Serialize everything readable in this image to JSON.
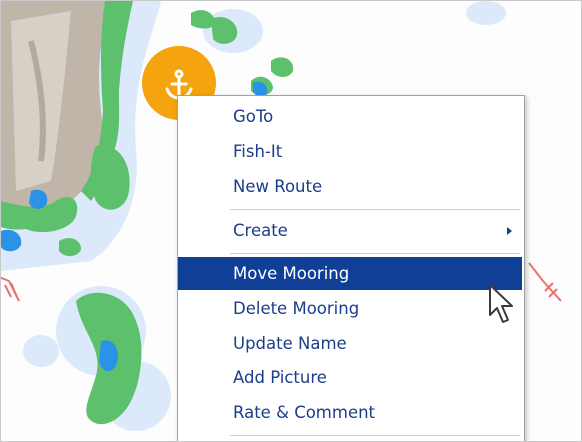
{
  "context_menu": {
    "items": [
      {
        "label": "GoTo"
      },
      {
        "label": "Fish-It"
      },
      {
        "label": "New Route"
      },
      {
        "label": "Create"
      },
      {
        "label": "Move Mooring"
      },
      {
        "label": "Delete Mooring"
      },
      {
        "label": "Update Name"
      },
      {
        "label": "Add Picture"
      },
      {
        "label": "Rate & Comment"
      }
    ],
    "highlighted_item": "Move Mooring",
    "submenu_item": "Create"
  },
  "map": {
    "selected_marker_icon": "anchor-icon",
    "right_marker_icon": "fishing-marker-icon",
    "left_marker_icon": "fishing-marker-icon"
  },
  "colors": {
    "menu_text": "#1b3d8a",
    "menu_highlight": "#0f3f97",
    "island_green": "#5dc06d",
    "shallow_blue": "#2a93e6",
    "light_water": "#dbe9fb",
    "marker_orange": "#f5a30f",
    "fishing_marker": "#e8736f"
  }
}
